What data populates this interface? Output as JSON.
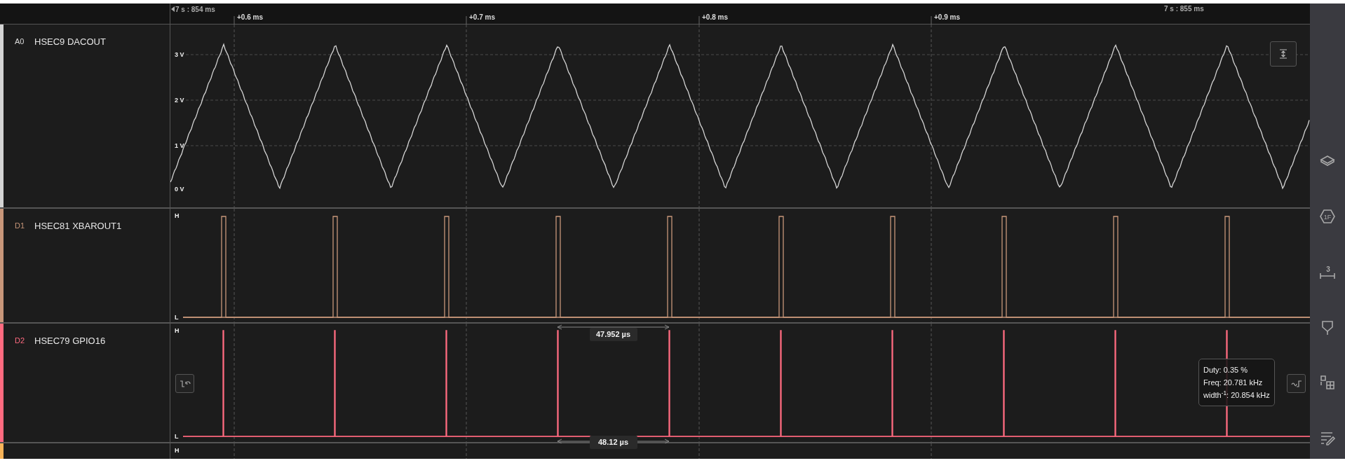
{
  "ruler": {
    "start": "7 s : 854 ms",
    "end": "7 s : 855 ms",
    "marks": [
      "+0.6 ms",
      "+0.7 ms",
      "+0.8 ms",
      "+0.9 ms"
    ]
  },
  "channels": [
    {
      "kind": "analog",
      "id": "A0",
      "name": "HSEC9 DACOUT",
      "color": "#d4d4d4",
      "y_labels": [
        "3 V",
        "2 V",
        "1 V",
        "0 V"
      ]
    },
    {
      "kind": "digital",
      "id": "D1",
      "name": "HSEC81 XBAROUT1",
      "color": "#c8977a",
      "high_label": "H",
      "low_label": "L"
    },
    {
      "kind": "spike",
      "id": "D2",
      "name": "HSEC79 GPIO16",
      "color": "#ff6b80",
      "high_label": "H",
      "low_label": "L",
      "measurements": [
        "47.952 µs",
        "48.12 µs"
      ],
      "tooltip": [
        "Duty: 0.35 %",
        "Freq: 20.781 kHz",
        "width$^{-1}$: 20.854 kHz"
      ]
    },
    {
      "kind": "partial",
      "color": "#f7b358",
      "high_label": "H"
    }
  ],
  "sidebar": {
    "items": [
      {
        "kind": "layers"
      },
      {
        "kind": "hex",
        "text": "1F"
      },
      {
        "kind": "measure",
        "text": "3"
      },
      {
        "kind": "marker"
      },
      {
        "kind": "grid"
      },
      {
        "kind": "notes"
      }
    ]
  }
}
